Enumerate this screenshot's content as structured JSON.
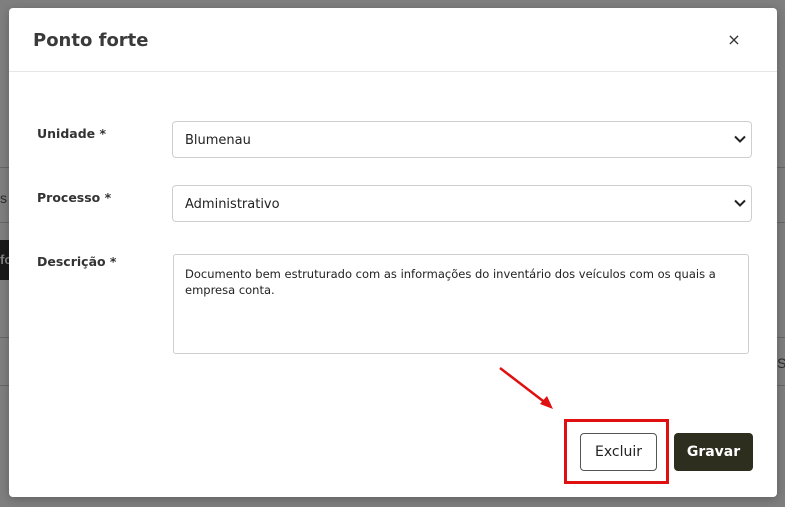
{
  "background": {
    "fragment_left_1": "s",
    "fragment_left_2": "fo",
    "fragment_right_1": "Se"
  },
  "modal": {
    "title": "Ponto forte",
    "close_label": "×",
    "fields": {
      "unidade": {
        "label": "Unidade *",
        "value": "Blumenau"
      },
      "processo": {
        "label": "Processo *",
        "value": "Administrativo"
      },
      "descricao": {
        "label": "Descrição *",
        "value": "Documento bem estruturado com as informações do inventário dos veículos com os quais a empresa conta."
      }
    },
    "buttons": {
      "delete_label": "Excluir",
      "save_label": "Gravar"
    }
  },
  "colors": {
    "save_button_bg": "#2e2e1f",
    "highlight": "#e01010",
    "overlay": "rgba(0,0,0,0.5)"
  },
  "icons": [
    "close-icon",
    "chevron-down-icon",
    "annotation-arrow"
  ]
}
